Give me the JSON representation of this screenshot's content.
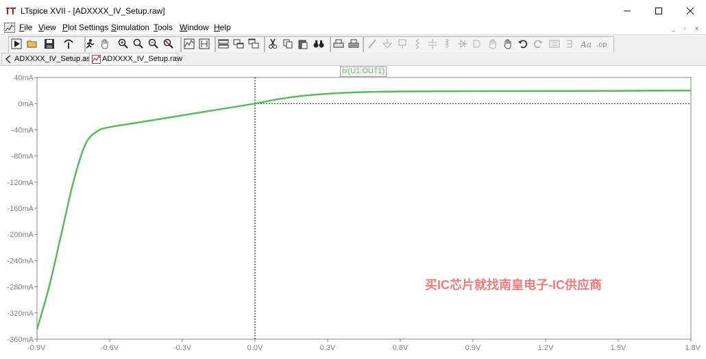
{
  "window": {
    "title": "LTspice XVII - [ADXXXX_IV_Setup.raw]",
    "minimize": "—",
    "maximize": "☐",
    "close": "✕"
  },
  "menu": {
    "items": [
      "File",
      "View",
      "Plot Settings",
      "Simulation",
      "Tools",
      "Window",
      "Help"
    ],
    "mdi": [
      "_",
      "▫",
      "x"
    ]
  },
  "toolbar": {
    "icons": [
      "run-icon",
      "open-icon",
      "save-icon",
      "control-panel-icon",
      "halt-icon",
      "pan-icon",
      "zoom-in-icon",
      "zoom-area-icon",
      "zoom-out-icon",
      "zoom-fit-icon",
      "autorange-icon",
      "schematic-view-icon",
      "tile-horizontal-icon",
      "tile-vertical-icon",
      "cascade-icon",
      "cut-icon",
      "copy-icon",
      "paste-icon",
      "find-icon",
      "print-icon",
      "print-setup-icon",
      "wire-icon",
      "ground-icon",
      "label-icon",
      "resistor-icon",
      "capacitor-icon",
      "inductor-icon",
      "diode-icon",
      "component-icon",
      "move-icon",
      "drag-icon",
      "undo-icon",
      "redo-icon",
      "rotate-icon",
      "mirror-icon",
      "text-icon",
      "spice-directive-icon"
    ]
  },
  "tabs": [
    {
      "label": "ADXXXX_IV_Setup.asc",
      "icon": "schematic-icon"
    },
    {
      "label": "ADXXXX_IV_Setup.raw",
      "icon": "waveform-icon",
      "active": true
    }
  ],
  "plot": {
    "trace_name": "Ix(U1:OUT1)",
    "trace_color": "#5cb85c",
    "axis_label_color": "#808080",
    "y_ticks": [
      "40mA",
      "0mA",
      "-40mA",
      "-80mA",
      "-120mA",
      "-160mA",
      "-200mA",
      "-240mA",
      "-280mA",
      "-320mA",
      "-360mA"
    ],
    "x_ticks": [
      "-0.9V",
      "-0.6V",
      "-0.3V",
      "0.0V",
      "0.3V",
      "0.6V",
      "0.9V",
      "1.2V",
      "1.5V",
      "1.8V"
    ]
  },
  "chart_data": {
    "type": "line",
    "series": [
      {
        "name": "Ix(U1:OUT1)",
        "x": [
          -0.9,
          -0.85,
          -0.8,
          -0.75,
          -0.7,
          -0.65,
          -0.6,
          -0.5,
          -0.4,
          -0.3,
          -0.2,
          -0.1,
          0.0,
          0.1,
          0.2,
          0.3,
          0.4,
          0.5,
          0.6,
          0.9,
          1.2,
          1.5,
          1.8
        ],
        "y": [
          -345,
          -280,
          -200,
          -120,
          -62,
          -42,
          -36,
          -30,
          -24,
          -18,
          -12,
          -6,
          0,
          7,
          12,
          15,
          17,
          18,
          18.5,
          19,
          19.3,
          19.5,
          20
        ]
      }
    ],
    "xlim": [
      -0.9,
      1.8
    ],
    "ylim": [
      -360,
      40
    ],
    "grid": false
  },
  "watermark": {
    "text": "买IC芯片就找南皇电子-IC供应商",
    "color": "#f07c7c"
  }
}
